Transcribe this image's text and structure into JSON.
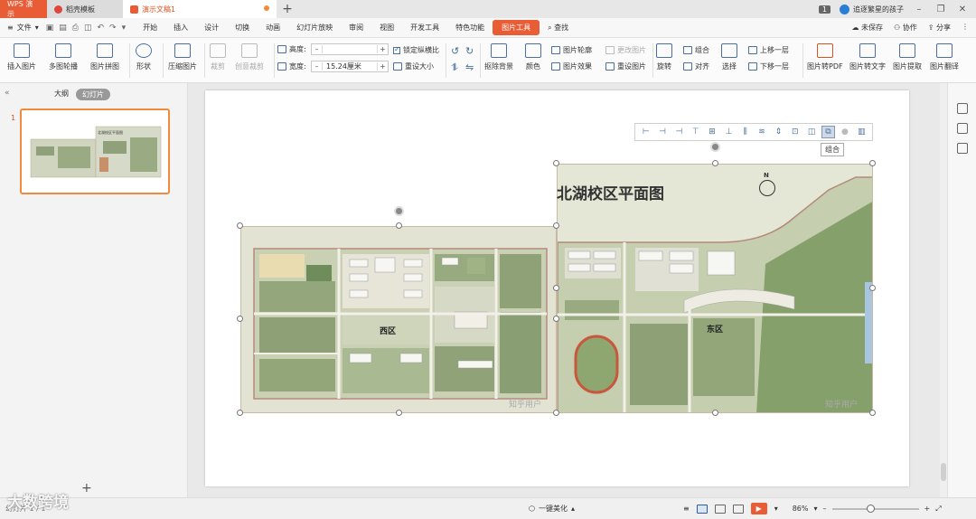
{
  "titlebar": {
    "app_tab": "WPS 演示",
    "tab1": "稻壳模板",
    "tab2": "演示文稿1",
    "new_tab": "+",
    "badge": "1",
    "user": "追逐繁星的孩子",
    "min": "–",
    "restore": "❐",
    "close": "✕"
  },
  "menubar": {
    "file": "文件",
    "items": [
      "开始",
      "插入",
      "设计",
      "切换",
      "动画",
      "幻灯片放映",
      "审阅",
      "视图",
      "开发工具",
      "特色功能",
      "图片工具"
    ],
    "search": "查找",
    "unsaved": "未保存",
    "collab": "协作",
    "share": "分享"
  },
  "ribbon": {
    "insert_image": "插入图片",
    "multi_outline": "多图轮播",
    "image_collage": "图片拼图",
    "shape": "形状",
    "compress": "压缩图片",
    "crop": "裁剪",
    "creative_crop": "创意裁剪",
    "height_label": "高度:",
    "height_value": "",
    "width_label": "宽度:",
    "width_value": "15.24厘米",
    "lock_ratio": "锁定纵横比",
    "reset_size": "重设大小",
    "remove_bg": "抠除背景",
    "color": "颜色",
    "outline": "图片轮廓",
    "effect": "图片效果",
    "change_img": "更改图片",
    "reset_img": "重设图片",
    "rotate": "旋转",
    "group": "组合",
    "align": "对齐",
    "select": "选择",
    "bring_forward": "上移一层",
    "send_backward": "下移一层",
    "to_pdf": "图片转PDF",
    "to_text": "图片转文字",
    "extract": "图片提取",
    "translate": "图片翻译"
  },
  "leftpanel": {
    "tab_outline": "大纲",
    "tab_slides": "幻灯片",
    "slide_number": "1",
    "collapse": "«"
  },
  "slide": {
    "map_title": "北湖校区平面图",
    "west_label": "西区",
    "east_label": "东区",
    "north": "N",
    "watermark": "知乎用户",
    "tooltip": "组合"
  },
  "statusbar": {
    "slide_info": "幻灯片 1 / 1",
    "beautify": "一键美化",
    "zoom": "86%",
    "zoom_minus": "–",
    "zoom_plus": "+"
  },
  "watermark_logo": "大数跨境"
}
